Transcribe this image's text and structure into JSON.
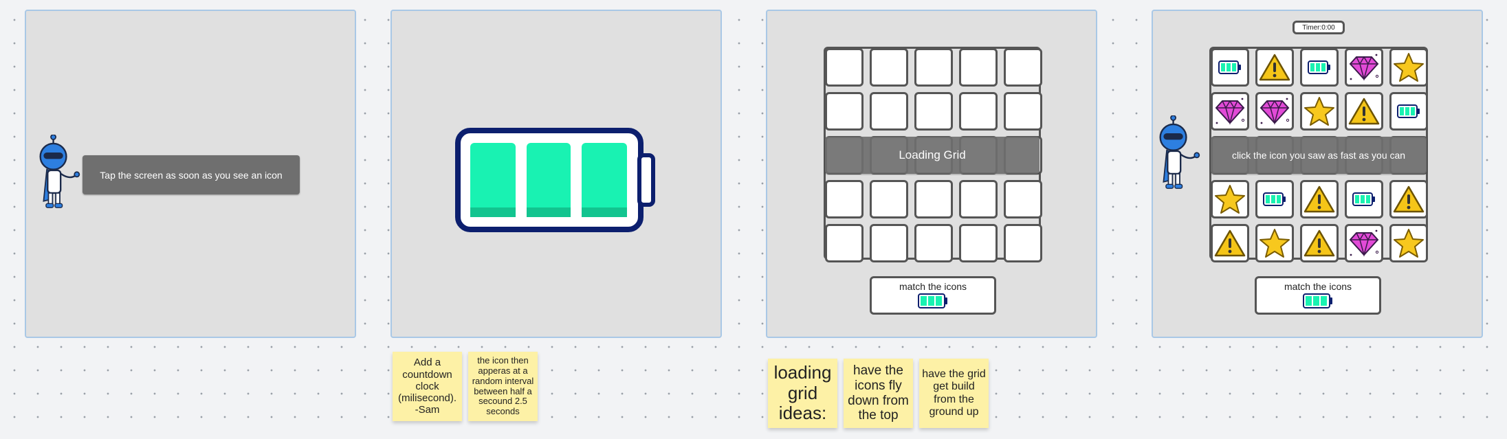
{
  "frame1": {
    "instruction": "Tap the screen as soon as you see an icon"
  },
  "frame3": {
    "loading_label": "Loading Grid",
    "match_label": "match the icons",
    "match_icon": "battery-icon"
  },
  "frame4": {
    "timer": "Timer:0:00",
    "instruction": "click the icon you saw as fast as you can",
    "match_label": "match the icons",
    "match_icon": "battery-icon",
    "grid_icons": [
      [
        "battery",
        "warning",
        "battery",
        "gem",
        "star"
      ],
      [
        "gem",
        "gem",
        "star",
        "warning",
        "battery"
      ],
      [
        "hidden",
        "hidden",
        "hidden",
        "hidden",
        "hidden"
      ],
      [
        "star",
        "battery",
        "warning",
        "battery",
        "warning"
      ],
      [
        "warning",
        "star",
        "warning",
        "gem",
        "star"
      ]
    ]
  },
  "notes": {
    "note1": "Add a countdown clock (milisecond). -Sam",
    "note2": "the icon then apperas at a random interval between half a secound 2.5 seconds",
    "note3": "loading grid ideas:",
    "note4": "have the icons fly down from the top",
    "note5": "have the grid get build from the ground up"
  },
  "colors": {
    "battery_fill": "#19f2b2",
    "battery_outline": "#0c1f6e",
    "star": "#f7c81e",
    "warning": "#f5c518",
    "gem": "#e24ad7",
    "robot_blue": "#2d7fe0"
  }
}
